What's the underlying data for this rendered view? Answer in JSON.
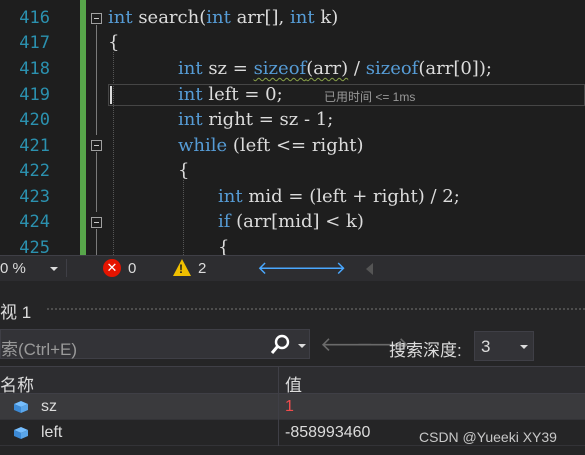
{
  "editor": {
    "line_numbers": [
      "416",
      "417",
      "418",
      "419",
      "420",
      "421",
      "422",
      "423",
      "424",
      "425"
    ],
    "lines": [
      [
        {
          "t": "int",
          "c": "kw"
        },
        {
          "t": " search(",
          "c": ""
        },
        {
          "t": "int",
          "c": "kw"
        },
        {
          "t": " arr[], ",
          "c": ""
        },
        {
          "t": "int",
          "c": "kw"
        },
        {
          "t": " k)",
          "c": ""
        }
      ],
      [
        {
          "t": "{",
          "c": ""
        }
      ],
      [
        {
          "t": "int",
          "c": "kw"
        },
        {
          "t": " sz = ",
          "c": ""
        },
        {
          "t": "sizeof",
          "c": "kw squig"
        },
        {
          "t": "(arr)",
          "c": "squig"
        },
        {
          "t": " / ",
          "c": ""
        },
        {
          "t": "sizeof",
          "c": "kw"
        },
        {
          "t": "(arr[0]);",
          "c": ""
        }
      ],
      [
        {
          "t": "int",
          "c": "kw"
        },
        {
          "t": " left = 0;",
          "c": ""
        }
      ],
      [
        {
          "t": "int",
          "c": "kw"
        },
        {
          "t": " right = sz - 1;",
          "c": ""
        }
      ],
      [
        {
          "t": "while",
          "c": "kw"
        },
        {
          "t": " (left <= right)",
          "c": ""
        }
      ],
      [
        {
          "t": "{",
          "c": ""
        }
      ],
      [
        {
          "t": "int",
          "c": "kw"
        },
        {
          "t": " mid = (left + right) / 2;",
          "c": ""
        }
      ],
      [
        {
          "t": "if",
          "c": "kw"
        },
        {
          "t": " (arr[mid] < k)",
          "c": ""
        }
      ],
      [
        {
          "t": "{",
          "c": ""
        }
      ]
    ],
    "perf_tip": "已用时间 <= 1ms"
  },
  "statusbar": {
    "zoom": "0 %",
    "errors": "0",
    "warnings": "2",
    "error_icon": "x-circle-icon",
    "warning_icon": "warning-triangle-icon"
  },
  "watch": {
    "title": "视 1",
    "search_placeholder": "索(Ctrl+E)",
    "depth_label": "搜索深度:",
    "depth_value": "3",
    "col_name": "名称",
    "col_value": "值",
    "rows": [
      {
        "name": "sz",
        "value": "1",
        "changed": true
      },
      {
        "name": "left",
        "value": "-858993460",
        "changed": false
      }
    ],
    "value_changed_color": "#f14c4c"
  },
  "watermark": "CSDN @Yueeki XY39",
  "colors": {
    "keyword": "#569cd6",
    "line_number": "#2b91af",
    "accent_blue": "#4aa8ff",
    "error": "#e51400",
    "warning": "#f0c000"
  }
}
